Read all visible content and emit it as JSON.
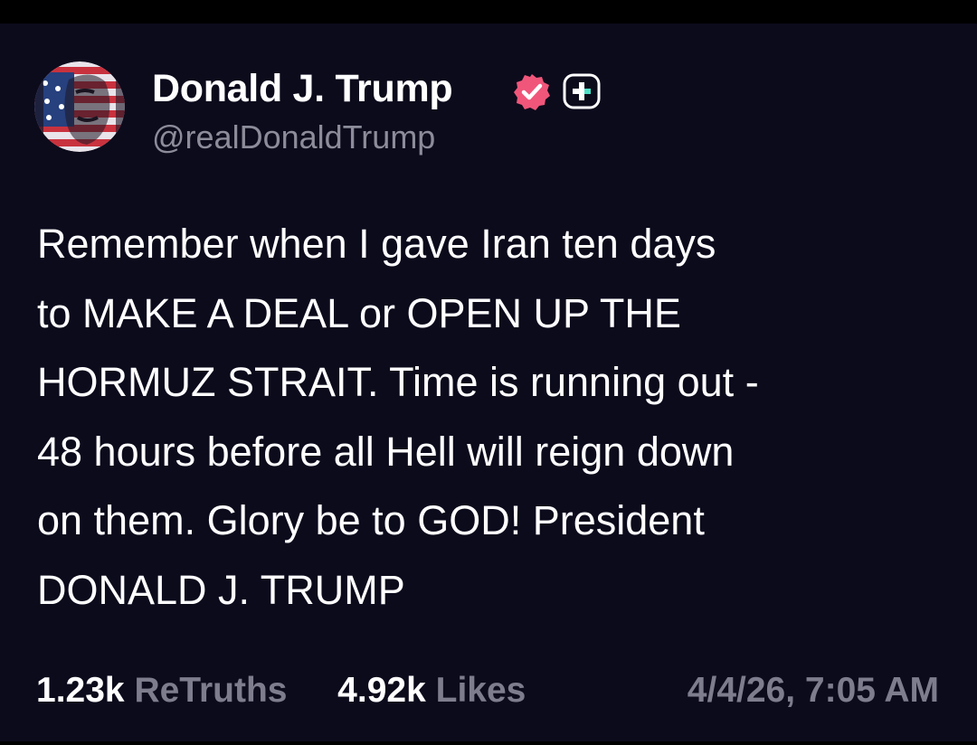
{
  "post": {
    "author": {
      "display_name": "Donald J. Trump",
      "handle": "@realDonaldTrump",
      "avatar_icon": "flag-portrait-avatar",
      "verified_icon": "verified-badge-icon",
      "follow_icon": "follow-plus-icon"
    },
    "text": "Remember when I gave Iran ten days\nto MAKE A DEAL or OPEN UP THE\nHORMUZ STRAIT. Time is running out -\n48 hours before all Hell will reign down\non them. Glory be to GOD! President\nDONALD J. TRUMP",
    "stats": {
      "retruths_count": "1.23k",
      "retruths_label": "ReTruths",
      "likes_count": "4.92k",
      "likes_label": "Likes"
    },
    "timestamp": "4/4/26, 7:05 AM"
  },
  "colors": {
    "background": "#0c0b1c",
    "text": "#ffffff",
    "muted": "#8c8c9a",
    "verified_pink": "#f0567a",
    "follow_teal": "#4ee0c8"
  }
}
